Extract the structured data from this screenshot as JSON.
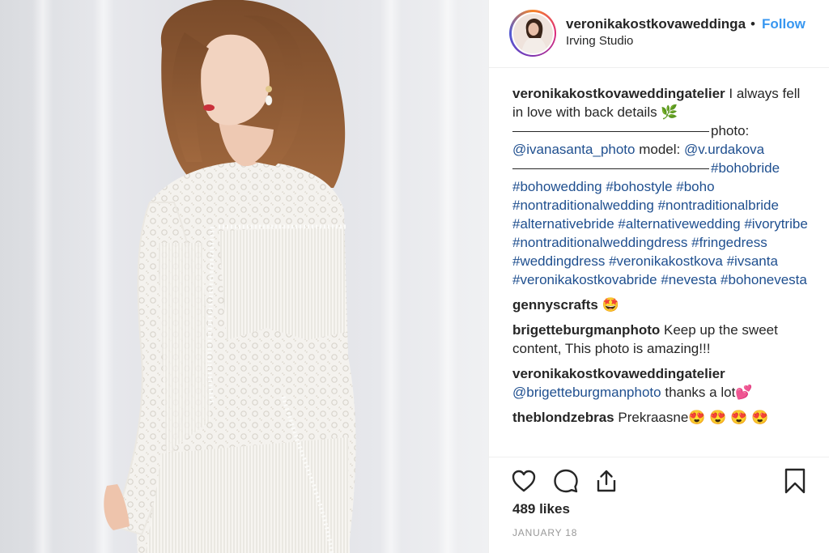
{
  "post": {
    "photo_alt": "Woman in white lace fringe wedding dress seen from the back",
    "header": {
      "username": "veronikakostkovaweddinga",
      "separator": "•",
      "follow_label": "Follow",
      "location": "Irving Studio"
    },
    "caption": {
      "username": "veronikakostkovaweddingatelier",
      "text_1": "I always fell in love with back details",
      "emoji_1": "🌿",
      "text_2": "photo:",
      "mention_1": "@ivanasanta_photo",
      "text_3": "model:",
      "mention_2": "@v.urdakova",
      "hashtags": "#bohobride #bohowedding #bohostyle #boho #nontraditionalwedding #nontraditionalbride #alternativebride #alternativewedding #ivorytribe #nontraditionalweddingdress #fringedress #weddingdress #veronikakostkova #ivsanta #veronikakostkovabride #nevesta #bohonevesta"
    },
    "comments": [
      {
        "username": "gennyscrafts",
        "text": "🤩"
      },
      {
        "username": "brigetteburgmanphoto",
        "text": "Keep up the sweet content, This photo is amazing!!!"
      },
      {
        "username": "veronikakostkovaweddingatelier",
        "mention": "@brigetteburgmanphoto",
        "text": "thanks a lot💕"
      },
      {
        "username": "theblondzebras",
        "text": "Prekraasne😍 😍 😍 😍"
      }
    ],
    "likes": "489 likes",
    "date": "JANUARY 18"
  },
  "icons": [
    "heart-icon",
    "comment-icon",
    "share-icon",
    "bookmark-icon"
  ],
  "colors": {
    "link": "#1f4f8f",
    "follow": "#3897f0",
    "text": "#262626",
    "muted": "#999999"
  }
}
